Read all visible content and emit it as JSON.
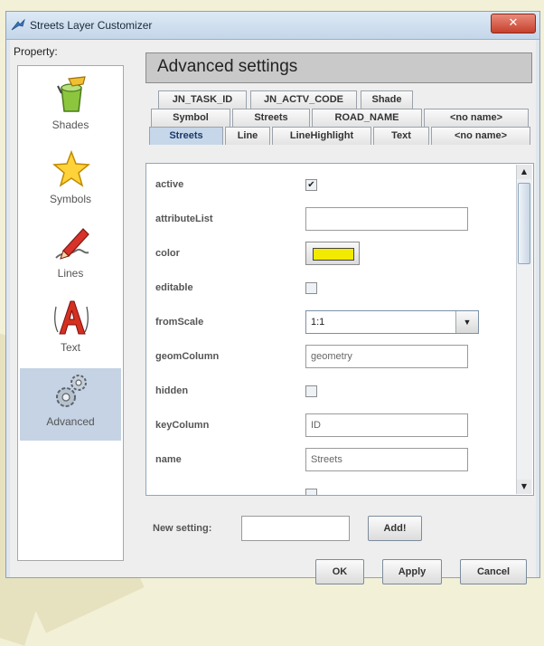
{
  "window": {
    "title": "Streets Layer Customizer",
    "close_glyph": "✕"
  },
  "sidebar": {
    "label": "Property:",
    "items": [
      {
        "label": "Shades",
        "icon": "paint-bucket-icon"
      },
      {
        "label": "Symbols",
        "icon": "star-icon"
      },
      {
        "label": "Lines",
        "icon": "pen-icon"
      },
      {
        "label": "Text",
        "icon": "text-a-icon"
      },
      {
        "label": "Advanced",
        "icon": "gears-icon",
        "selected": true
      }
    ]
  },
  "main": {
    "header": "Advanced settings",
    "tabs_row1": [
      "JN_TASK_ID",
      "JN_ACTV_CODE",
      "Shade"
    ],
    "tabs_row2": [
      "Symbol",
      "Streets",
      "ROAD_NAME",
      "<no name>"
    ],
    "tabs_row3": [
      "Streets",
      "Line",
      "LineHighlight",
      "Text",
      "<no name>"
    ],
    "selected_tab": "Streets",
    "properties": [
      {
        "name": "active",
        "type": "checkbox",
        "checked": true
      },
      {
        "name": "attributeList",
        "type": "text",
        "value": ""
      },
      {
        "name": "color",
        "type": "color",
        "value": "#f2ea00"
      },
      {
        "name": "editable",
        "type": "checkbox",
        "checked": false
      },
      {
        "name": "fromScale",
        "type": "combo",
        "value": "1:1"
      },
      {
        "name": "geomColumn",
        "type": "text",
        "value": "geometry"
      },
      {
        "name": "hidden",
        "type": "checkbox",
        "checked": false
      },
      {
        "name": "keyColumn",
        "type": "text",
        "value": "ID"
      },
      {
        "name": "name",
        "type": "text",
        "value": "Streets"
      },
      {
        "name": "",
        "type": "checkbox",
        "checked": false
      }
    ],
    "new_setting_label": "New setting:",
    "new_setting_value": "",
    "add_button": "Add!"
  },
  "footer": {
    "ok": "OK",
    "apply": "Apply",
    "cancel": "Cancel"
  },
  "colors": {
    "selected_tab": "#c7d7ea",
    "swatch": "#f2ea00",
    "close_button": "#c6402c"
  }
}
